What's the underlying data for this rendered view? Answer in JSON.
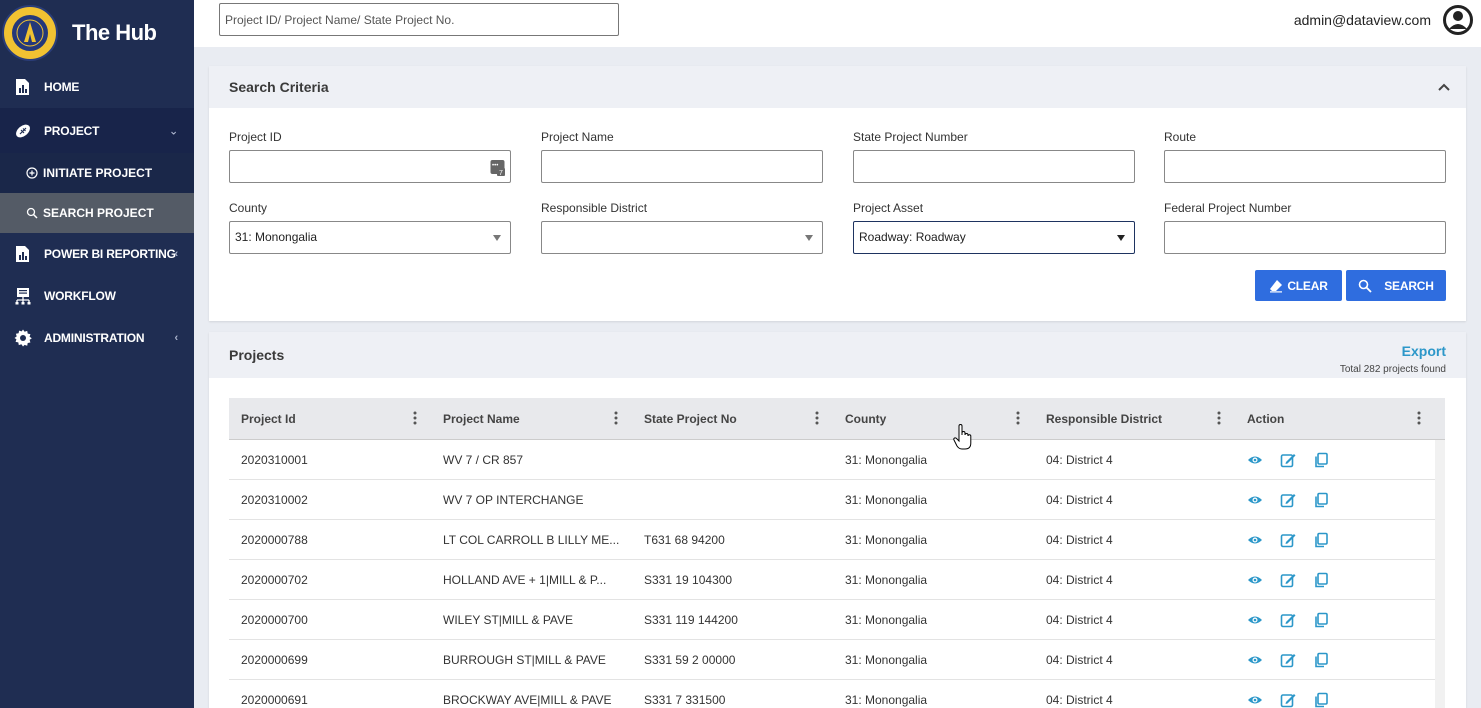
{
  "app": {
    "title": "The Hub"
  },
  "topbar": {
    "search_placeholder": "Project ID/ Project Name/ State Project No.",
    "user_email": "admin@dataview.com"
  },
  "sidebar": {
    "items": [
      {
        "label": "HOME",
        "icon": "chart-icon"
      },
      {
        "label": "PROJECT",
        "icon": "football-icon"
      },
      {
        "label": "INITIATE PROJECT",
        "icon": "plus-circle-icon"
      },
      {
        "label": "SEARCH PROJECT",
        "icon": "search-icon"
      },
      {
        "label": "POWER BI REPORTING",
        "icon": "report-icon"
      },
      {
        "label": "WORKFLOW",
        "icon": "workflow-icon"
      },
      {
        "label": "ADMINISTRATION",
        "icon": "gear-icon"
      }
    ]
  },
  "criteria": {
    "title": "Search Criteria",
    "fields": {
      "project_id": {
        "label": "Project ID",
        "value": ""
      },
      "project_name": {
        "label": "Project Name",
        "value": ""
      },
      "state_project_number": {
        "label": "State Project Number",
        "value": ""
      },
      "route": {
        "label": "Route",
        "value": ""
      },
      "county": {
        "label": "County",
        "value": "31: Monongalia"
      },
      "responsible_district": {
        "label": "Responsible District",
        "value": ""
      },
      "project_asset": {
        "label": "Project Asset",
        "value": "Roadway: Roadway"
      },
      "federal_project_number": {
        "label": "Federal Project Number",
        "value": ""
      }
    },
    "clear_label": "CLEAR",
    "search_label": "SEARCH"
  },
  "projects": {
    "title": "Projects",
    "export_label": "Export",
    "total_text": "Total 282 projects found",
    "columns": [
      "Project Id",
      "Project Name",
      "State Project No",
      "County",
      "Responsible District",
      "Action"
    ],
    "rows": [
      [
        "2020310001",
        "WV 7 / CR 857",
        "",
        "31: Monongalia",
        "04: District 4"
      ],
      [
        "2020310002",
        "WV 7 OP INTERCHANGE",
        "",
        "31: Monongalia",
        "04: District 4"
      ],
      [
        "2020000788",
        "LT COL CARROLL B LILLY ME...",
        "T631 68 94200",
        "31: Monongalia",
        "04: District 4"
      ],
      [
        "2020000702",
        "HOLLAND AVE + 1|MILL & P...",
        "S331 19 104300",
        "31: Monongalia",
        "04: District 4"
      ],
      [
        "2020000700",
        "WILEY ST|MILL & PAVE",
        "S331 119 144200",
        "31: Monongalia",
        "04: District 4"
      ],
      [
        "2020000699",
        "BURROUGH ST|MILL & PAVE",
        "S331 59 2 00000",
        "31: Monongalia",
        "04: District 4"
      ],
      [
        "2020000691",
        "BROCKWAY AVE|MILL & PAVE",
        "S331 7 331500",
        "31: Monongalia",
        "04: District 4"
      ]
    ]
  },
  "colors": {
    "sidebar": "#1f2d52",
    "accent": "#2f6ddf",
    "action_icon": "#2c97c9"
  }
}
